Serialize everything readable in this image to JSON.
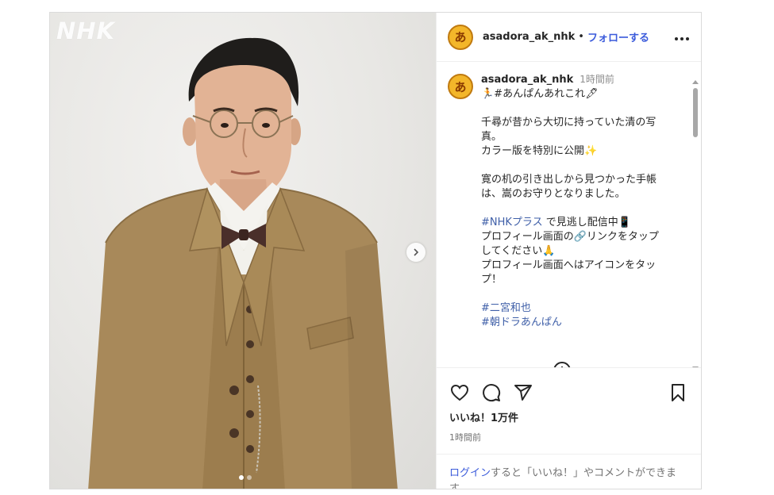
{
  "media": {
    "watermark": "NHK",
    "slide_count": 2,
    "active_slide": 0
  },
  "header": {
    "username": "asadora_ak_nhk",
    "separator": "•",
    "follow_label": "フォローする",
    "more_label": "•••"
  },
  "avatar": {
    "glyph": "あ",
    "color": "#f3b62a"
  },
  "caption": {
    "username": "asadora_ak_nhk",
    "time": "1時間前",
    "lines": [
      {
        "text": "🏃#あんぱんあれこれ🖋",
        "hashtag": false
      },
      {
        "text": "",
        "hashtag": false
      },
      {
        "text": "千尋が昔から大切に持っていた清の写",
        "hashtag": false
      },
      {
        "text": "真。",
        "hashtag": false
      },
      {
        "text": "カラー版を特別に公開✨",
        "hashtag": false
      },
      {
        "text": "",
        "hashtag": false
      },
      {
        "text": "寛の机の引き出しから見つかった手帳",
        "hashtag": false
      },
      {
        "text": "は、嵩のお守りとなりました。",
        "hashtag": false
      },
      {
        "text": "",
        "hashtag": false
      },
      {
        "text": "#NHKプラス",
        "suffix": " で見逃し配信中📱",
        "hashtag": true
      },
      {
        "text": "プロフィール画面の🔗リンクをタップ",
        "hashtag": false
      },
      {
        "text": "してください🙏",
        "hashtag": false
      },
      {
        "text": "プロフィール画面へはアイコンをタッ",
        "hashtag": false
      },
      {
        "text": "プ！",
        "hashtag": false
      },
      {
        "text": "",
        "hashtag": false
      },
      {
        "text": "#二宮和也",
        "hashtag": true
      },
      {
        "text": "#朝ドラあんぱん",
        "hashtag": true
      }
    ]
  },
  "actions": {
    "like_icon": "heart-icon",
    "comment_icon": "comment-icon",
    "share_icon": "share-icon",
    "save_icon": "bookmark-icon"
  },
  "likes": "いいね！1万件",
  "post_time": "1時間前",
  "login_prompt": {
    "link": "ログイン",
    "text": "すると「いいね！」やコメントができます。"
  },
  "colors": {
    "link": "#3b5bdb",
    "hashtag": "#3f5fa8",
    "muted": "#8e8e8e"
  }
}
